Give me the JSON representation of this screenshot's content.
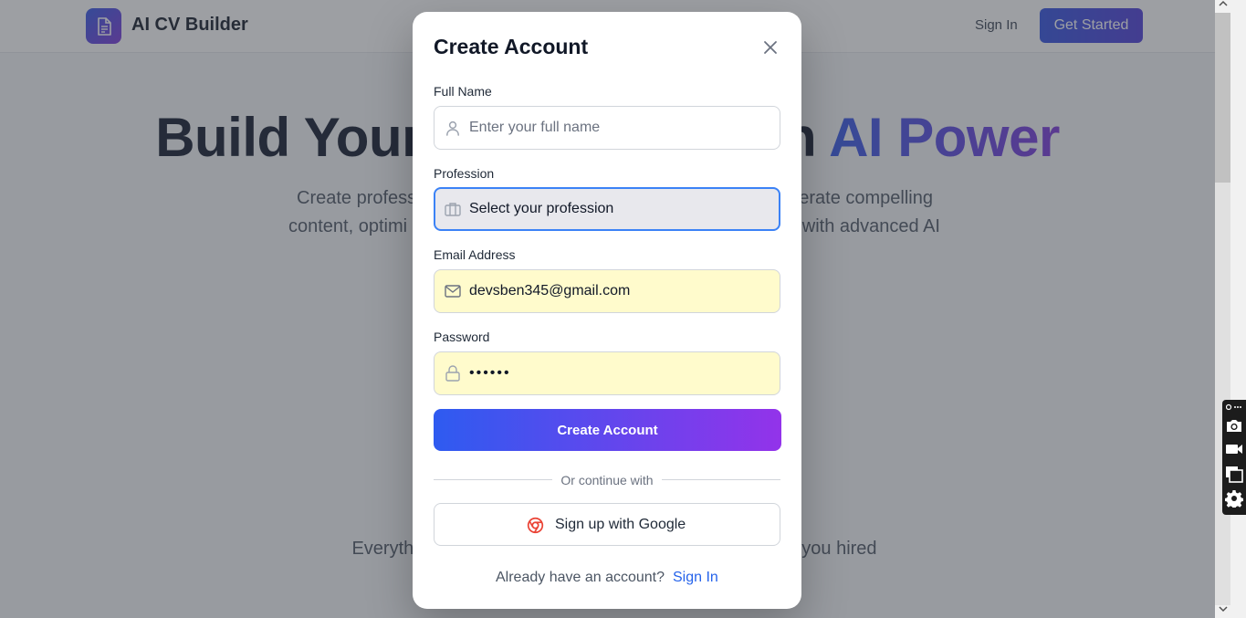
{
  "app": {
    "logo_text": "AI CV Builder",
    "nav_signin": "Sign In",
    "nav_get_started": "Get Started"
  },
  "hero": {
    "title_left": "Build Your",
    "title_right_plain": "h",
    "title_right_gradient": "AI Power",
    "subtitle_line1_left": "Create profess",
    "subtitle_line1_right": "erate compelling",
    "subtitle_line2_left": "content, optimi",
    "subtitle_line2_right": "with advanced AI",
    "note_left": "Everyth",
    "note_right": "you hired"
  },
  "modal": {
    "title": "Create Account",
    "full_name_label": "Full Name",
    "full_name_placeholder": "Enter your full name",
    "profession_label": "Profession",
    "profession_value": "Select your profession",
    "email_label": "Email Address",
    "email_value": "devsben345@gmail.com",
    "password_label": "Password",
    "password_value": "••••••",
    "submit_label": "Create Account",
    "divider_text": "Or continue with",
    "google_label": "Sign up with Google",
    "footer_text": "Already have an account?",
    "footer_link": "Sign In"
  },
  "colors": {
    "accent_start": "#2e5bf0",
    "accent_end": "#9333ea",
    "link": "#2563eb",
    "autofill_bg": "#fffbcc",
    "google_red": "#ea4335"
  },
  "icons": {
    "logo": "document-icon",
    "close": "close-icon",
    "full_name": "user-icon",
    "profession": "briefcase-icon",
    "email": "mail-icon",
    "password": "lock-icon",
    "google": "chrome-icon",
    "tools": [
      "link-icon",
      "camera-icon",
      "video-icon",
      "copy-icon",
      "gear-icon"
    ]
  }
}
